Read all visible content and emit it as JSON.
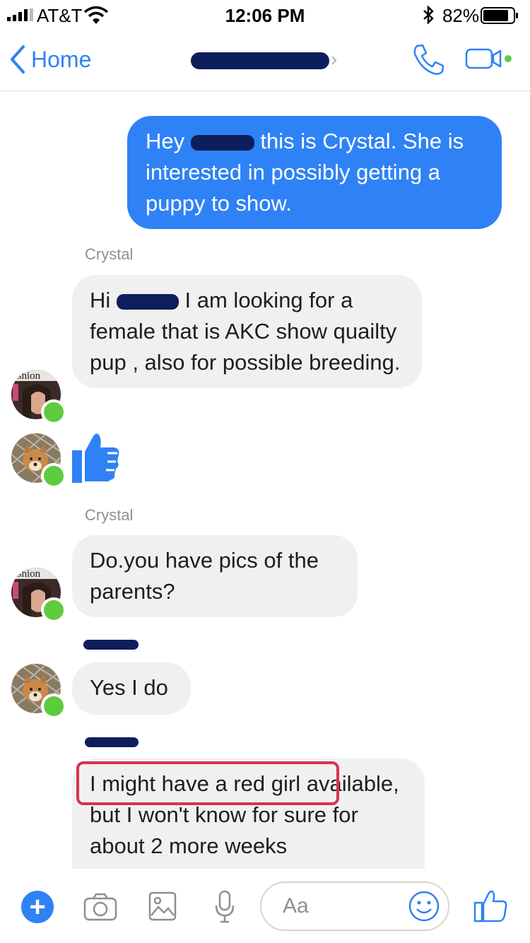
{
  "status": {
    "carrier": "AT&T",
    "time": "12:06 PM",
    "battery": "82%"
  },
  "nav": {
    "back_label": "Home"
  },
  "messages": [
    {
      "type": "sent",
      "before": "Hey",
      "after": "this is Crystal. She is interested in possibly getting a puppy to show."
    },
    {
      "type": "sender",
      "name": "Crystal"
    },
    {
      "type": "recv",
      "before": "Hi",
      "after": "I am looking for a female that is AKC show quailty pup , also for possible breeding."
    },
    {
      "type": "sender",
      "name": "Crystal"
    },
    {
      "type": "recv",
      "text": "Do.you have pics of the parents?"
    },
    {
      "type": "recv",
      "text": "Yes I do"
    },
    {
      "type": "recv",
      "highlight": "I might have a red girl",
      "text": "available, but I won't know for sure for about 2 more weeks"
    }
  ],
  "composer": {
    "placeholder": "Aa"
  },
  "colors": {
    "accent": "#2f82f5",
    "online": "#5ecb3f",
    "highlight": "#d8344e"
  }
}
